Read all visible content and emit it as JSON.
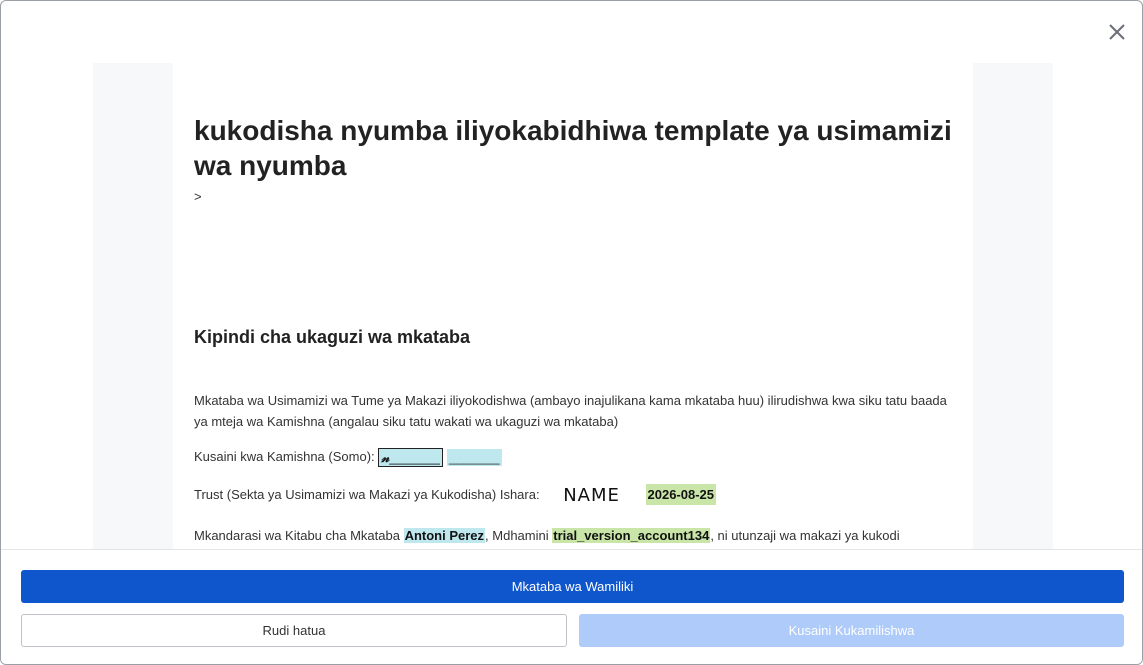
{
  "document": {
    "title": "kukodisha nyumba iliyokabidhiwa template ya usimamizi wa nyumba",
    "subtitle": ">",
    "section_title": "Kipindi cha ukaguzi wa mkataba",
    "para1": "Mkataba wa Usimamizi wa Tume ya Makazi iliyokodishwa (ambayo inajulikana kama mkataba huu) ilirudishwa kwa siku tatu baada ya mteja wa Kamishna (angalau siku tatu wakati wa ukaguzi wa mkataba)",
    "commissioner_label": "Kusaini kwa Kamishna (Somo):",
    "commissioner_signature_glyph": "𝓃",
    "commissioner_signature_blank": "_______",
    "commissioner_second_blank": "_______",
    "trust_label": "Trust (Sekta ya Usimamizi wa Makazi ya Kukodisha) Ishara:",
    "trust_signature": "NAME",
    "trust_date": "2026-08-25",
    "p4_prefix": "Mkandarasi wa Kitabu cha Mkataba ",
    "contractor_name": "Antoni Perez",
    "p4_middle": ", Mdhamini ",
    "account_name": "trial_version_account134",
    "p4_suffix": ", ni utunzaji wa makazi ya kukodi"
  },
  "footer": {
    "primary_label": "Mkataba wa Wamiliki",
    "back_label": "Rudi hatua",
    "complete_label": "Kusaini Kukamilishwa"
  },
  "colors": {
    "primary": "#0f56cc",
    "disabled": "#aecbf9",
    "highlight_blue": "#bfe8ee",
    "highlight_green": "#c9e5a8"
  }
}
